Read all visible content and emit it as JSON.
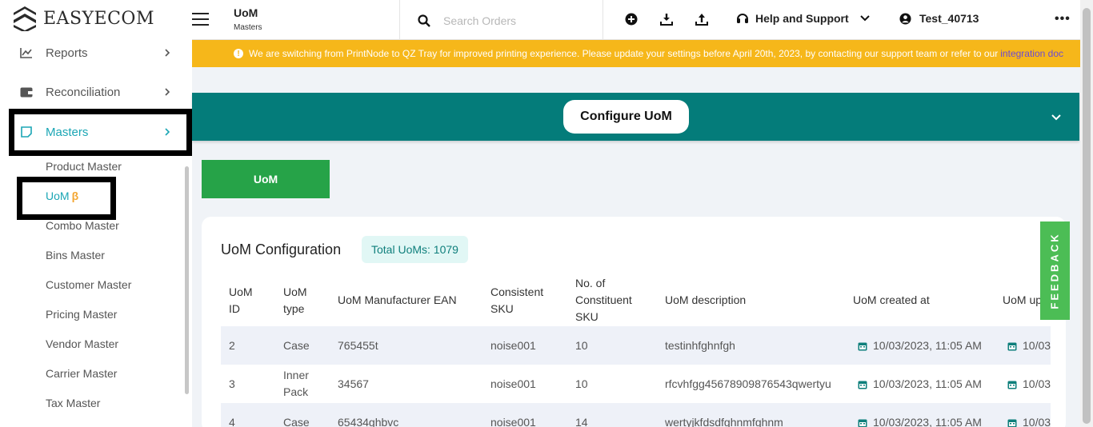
{
  "app": {
    "logo_text": "EASYECOM"
  },
  "topbar": {
    "title": "UoM",
    "subtitle": "Masters",
    "search_placeholder": "Search Orders",
    "help_label": "Help and Support",
    "user_label": "Test_40713",
    "more_label": "•••"
  },
  "banner": {
    "message": "We are switching from PrintNode to QZ Tray for improved printing experience. Please update your settings before April 20th, 2023, by contacting our support team or refer to our",
    "link_label": "integration doc"
  },
  "sidebar": {
    "items": [
      {
        "label": "Reports"
      },
      {
        "label": "Reconciliation"
      },
      {
        "label": "Masters"
      }
    ],
    "sub_items": [
      {
        "label": "Product Master"
      },
      {
        "label": "UoM",
        "badge": "β"
      },
      {
        "label": "Combo Master"
      },
      {
        "label": "Bins Master"
      },
      {
        "label": "Customer Master"
      },
      {
        "label": "Pricing Master"
      },
      {
        "label": "Vendor Master"
      },
      {
        "label": "Carrier Master"
      },
      {
        "label": "Tax Master"
      }
    ]
  },
  "config": {
    "button_label": "Configure UoM"
  },
  "tab": {
    "label": "UoM"
  },
  "card": {
    "title": "UoM Configuration",
    "badge": "Total UoMs: 1079"
  },
  "table": {
    "headers": [
      [
        "UoM",
        "ID"
      ],
      [
        "UoM",
        "type"
      ],
      [
        "UoM Manufacturer EAN"
      ],
      [
        "Consistent",
        "SKU"
      ],
      [
        "No. of",
        "Constituent",
        "SKU"
      ],
      [
        "UoM description"
      ],
      [
        "UoM created at"
      ],
      [
        "UoM up"
      ]
    ],
    "rows": [
      {
        "id": "2",
        "type": [
          "Case"
        ],
        "ean": "765455t",
        "sku": "noise001",
        "count": "10",
        "desc": "testinhfghnfgh",
        "created": "10/03/2023, 11:05 AM",
        "updated": "10/03"
      },
      {
        "id": "3",
        "type": [
          "Inner",
          "Pack"
        ],
        "ean": "34567",
        "sku": "noise001",
        "count": "10",
        "desc": "rfcvhfgg45678909876543qwertyu",
        "created": "10/03/2023, 11:05 AM",
        "updated": "10/03"
      },
      {
        "id": "4",
        "type": [
          "Case"
        ],
        "ean": "65434ghbvc",
        "sku": "noise001",
        "count": "14",
        "desc": "wertyjkfdsdfghnmfghnm",
        "created": "10/03/2023, 11:05 AM",
        "updated": "10/03"
      }
    ]
  },
  "feedback": {
    "label": "FEEDBACK"
  },
  "colors": {
    "teal": "#047c7a",
    "accent": "#1ba6b5",
    "green": "#26a348",
    "banner": "#f6b71a"
  }
}
